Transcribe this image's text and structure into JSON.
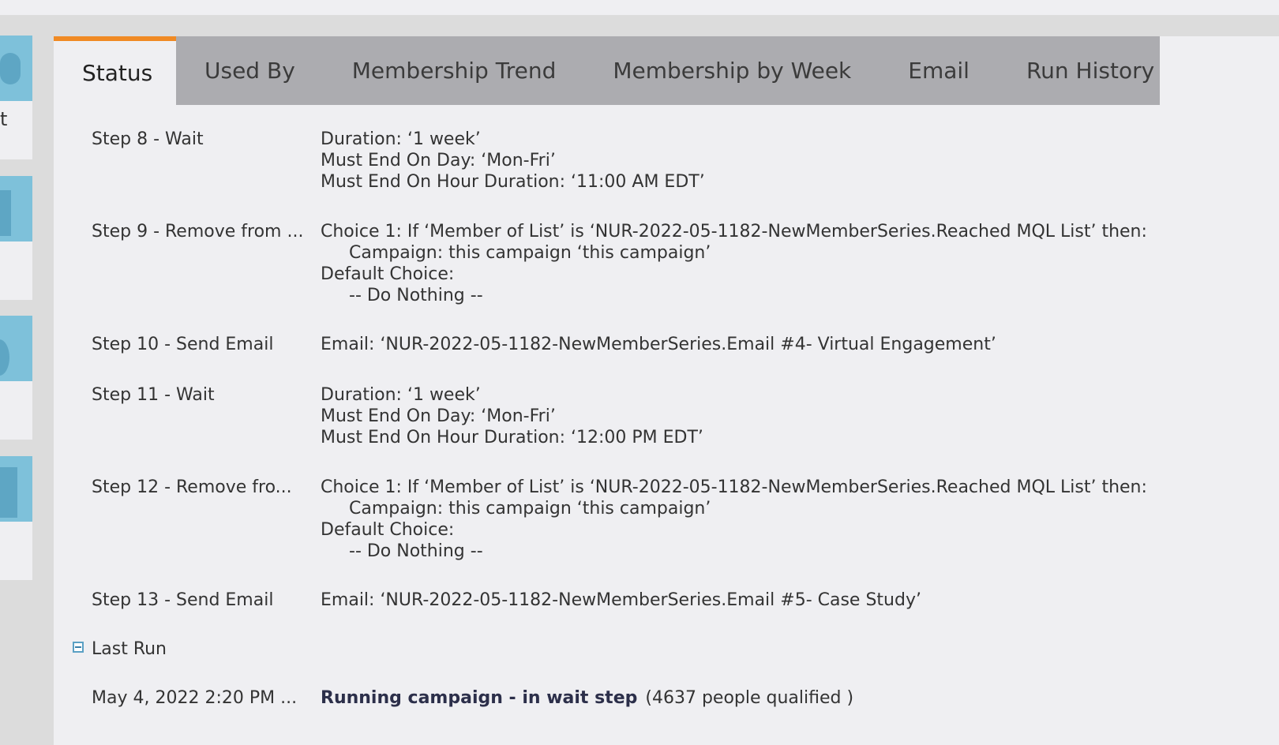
{
  "left_rail": {
    "tiles": [
      {
        "label": "t"
      },
      {
        "label": ""
      },
      {
        "label": ""
      },
      {
        "label": ""
      }
    ]
  },
  "tabs": [
    {
      "label": "Status",
      "active": true
    },
    {
      "label": "Used By",
      "active": false
    },
    {
      "label": "Membership Trend",
      "active": false
    },
    {
      "label": "Membership by Week",
      "active": false
    },
    {
      "label": "Email",
      "active": false
    },
    {
      "label": "Run History",
      "active": false
    }
  ],
  "steps": {
    "step8": {
      "label": "Step 8 - Wait",
      "lines": [
        "Duration: ‘1 week’",
        "Must End On Day: ‘Mon-Fri’",
        "Must End On Hour Duration: ‘11:00 AM EDT’"
      ]
    },
    "step9": {
      "label": "Step 9 - Remove from ...",
      "choice": "Choice 1: If ‘Member of List’ is ‘NUR-2022-05-1182-NewMemberSeries.Reached MQL List’ then:",
      "campaign": "Campaign: this campaign ‘this campaign’",
      "default": "Default Choice:",
      "nothing": "-- Do Nothing --"
    },
    "step10": {
      "label": "Step 10 - Send Email",
      "detail": "Email: ‘NUR-2022-05-1182-NewMemberSeries.Email #4- Virtual Engagement’"
    },
    "step11": {
      "label": "Step 11 - Wait",
      "lines": [
        "Duration: ‘1 week’",
        "Must End On Day: ‘Mon-Fri’",
        "Must End On Hour Duration: ‘12:00 PM EDT’"
      ]
    },
    "step12": {
      "label": "Step 12 - Remove fro...",
      "choice": "Choice 1: If ‘Member of List’ is ‘NUR-2022-05-1182-NewMemberSeries.Reached MQL List’ then:",
      "campaign": "Campaign: this campaign ‘this campaign’",
      "default": "Default Choice:",
      "nothing": "-- Do Nothing --"
    },
    "step13": {
      "label": "Step 13 - Send Email",
      "detail": "Email: ‘NUR-2022-05-1182-NewMemberSeries.Email #5- Case Study’"
    }
  },
  "last_run": {
    "heading": "Last Run",
    "timestamp": "May 4, 2022 2:20 PM ...",
    "status": "Running campaign - in wait step",
    "count": "(4637 people qualified )"
  },
  "colors": {
    "active_tab_accent": "#f08a24",
    "tab_bar": "#acacb0",
    "panel": "#efeff2",
    "tile": "#7ec1da"
  }
}
